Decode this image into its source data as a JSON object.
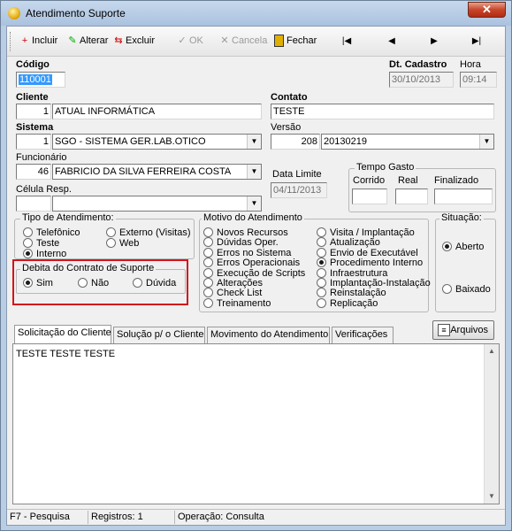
{
  "window": {
    "title": "Atendimento Suporte",
    "close_glyph": "✕"
  },
  "toolbar": {
    "incluir": "Incluir",
    "alterar": "Alterar",
    "excluir": "Excluir",
    "ok": "OK",
    "cancela": "Cancela",
    "fechar": "Fechar",
    "nav_first": "|◀",
    "nav_prev": "◀",
    "nav_next": "▶",
    "nav_last": "▶|"
  },
  "form": {
    "codigo_label": "Código",
    "codigo_value": "110001",
    "dt_cadastro_label": "Dt. Cadastro",
    "dt_cadastro_value": "30/10/2013",
    "hora_label": "Hora",
    "hora_value": "09:14",
    "cliente_label": "Cliente",
    "cliente_id": "1",
    "cliente_name": "ATUAL INFORMÁTICA",
    "contato_label": "Contato",
    "contato_value": "TESTE",
    "sistema_label": "Sistema",
    "sistema_id": "1",
    "sistema_name": "SGO - SISTEMA GER.LAB.OTICO",
    "versao_label": "Versão",
    "versao_id": "208",
    "versao_name": "20130219",
    "funcionario_label": "Funcionário",
    "funcionario_id": "46",
    "funcionario_name": "FABRICIO DA SILVA FERREIRA COSTA",
    "data_limite_label": "Data Limite",
    "data_limite_value": "04/11/2013",
    "celula_label": "Célula Resp.",
    "celula_id": "",
    "celula_name": "",
    "tempo_gasto_label": "Tempo Gasto",
    "corrido_label": "Corrido",
    "real_label": "Real",
    "finalizado_label": "Finalizado"
  },
  "tipo_atendimento": {
    "label": "Tipo de Atendimento:",
    "options": [
      "Telefônico",
      "Externo (Visitas)",
      "Teste",
      "Web",
      "Interno"
    ],
    "selected": "Interno"
  },
  "debita": {
    "label": "Debita do Contrato de Suporte",
    "options": [
      "Sim",
      "Não",
      "Dúvida"
    ],
    "selected": "Sim"
  },
  "motivo": {
    "label": "Motivo do Atendimento",
    "col1": [
      "Novos Recursos",
      "Dúvidas Oper.",
      "Erros no Sistema",
      "Erros Operacionais",
      "Execução de Scripts",
      "Alterações",
      "Check List",
      "Treinamento"
    ],
    "col2": [
      "Visita / Implantação",
      "Atualização",
      "Envio de Executável",
      "Procedimento Interno",
      "Infraestrutura",
      "Implantação-Instalação",
      "Reinstalação",
      "Replicação"
    ],
    "selected": "Procedimento Interno"
  },
  "situacao": {
    "label": "Situação:",
    "options": [
      "Aberto",
      "Baixado"
    ],
    "selected": "Aberto"
  },
  "tabs": [
    "Solicitação do Cliente",
    "Solução p/ o Cliente",
    "Movimento do Atendimento",
    "Verificações"
  ],
  "arquivos_button": "Arquivos",
  "memo_text": "TESTE TESTE TESTE",
  "statusbar": {
    "hint": "F7 - Pesquisa",
    "registros": "Registros: 1",
    "operacao": "Operação: Consulta"
  }
}
